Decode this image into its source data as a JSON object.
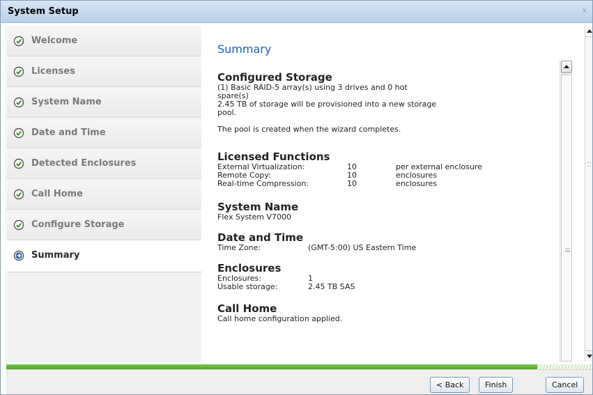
{
  "window": {
    "title": "System Setup",
    "close_glyph": "x"
  },
  "sidebar": {
    "items": [
      {
        "label": "Welcome",
        "state": "done",
        "icon": "check-circle-icon"
      },
      {
        "label": "Licenses",
        "state": "done",
        "icon": "check-circle-icon"
      },
      {
        "label": "System Name",
        "state": "done",
        "icon": "check-circle-icon"
      },
      {
        "label": "Date and Time",
        "state": "done",
        "icon": "check-circle-icon"
      },
      {
        "label": "Detected Enclosures",
        "state": "done",
        "icon": "check-circle-icon"
      },
      {
        "label": "Call Home",
        "state": "done",
        "icon": "check-circle-icon"
      },
      {
        "label": "Configure Storage",
        "state": "done",
        "icon": "check-circle-icon"
      },
      {
        "label": "Summary",
        "state": "current",
        "icon": "arrow-circle-icon"
      }
    ]
  },
  "main": {
    "title": "Summary",
    "configured_storage": {
      "heading": "Configured Storage",
      "line1": "(1) Basic RAID-5 array(s) using 3 drives and 0 hot",
      "line2": "spare(s)",
      "line3": "2.45 TB of storage will be provisioned into a new storage",
      "line4": "pool.",
      "note": "The pool is created when the wizard completes."
    },
    "licensed_functions": {
      "heading": "Licensed Functions",
      "rows": [
        {
          "name": "External Virtualization:",
          "value": "10",
          "unit": "per external enclosure"
        },
        {
          "name": "Remote Copy:",
          "value": "10",
          "unit": "enclosures"
        },
        {
          "name": "Real-time Compression:",
          "value": "10",
          "unit": "enclosures"
        }
      ]
    },
    "system_name": {
      "heading": "System Name",
      "value": "Flex System V7000"
    },
    "date_time": {
      "heading": "Date and Time",
      "label": "Time Zone:",
      "value": "(GMT-5:00) US Eastern Time"
    },
    "enclosures": {
      "heading": "Enclosures",
      "rows": [
        {
          "label": "Enclosures:",
          "value": "1"
        },
        {
          "label": "Usable storage:",
          "value": "2.45 TB SAS"
        }
      ]
    },
    "call_home": {
      "heading": "Call Home",
      "value": "Call home configuration applied."
    }
  },
  "progress": {
    "fraction": 0.905,
    "fill_color": "#5aad30"
  },
  "footer": {
    "back_label": "< Back",
    "finish_label": "Finish",
    "cancel_label": "Cancel"
  },
  "colors": {
    "accent_title": "#1a5fb4",
    "check_green": "#3d8b2a",
    "arrow_blue": "#2c5f9e"
  }
}
